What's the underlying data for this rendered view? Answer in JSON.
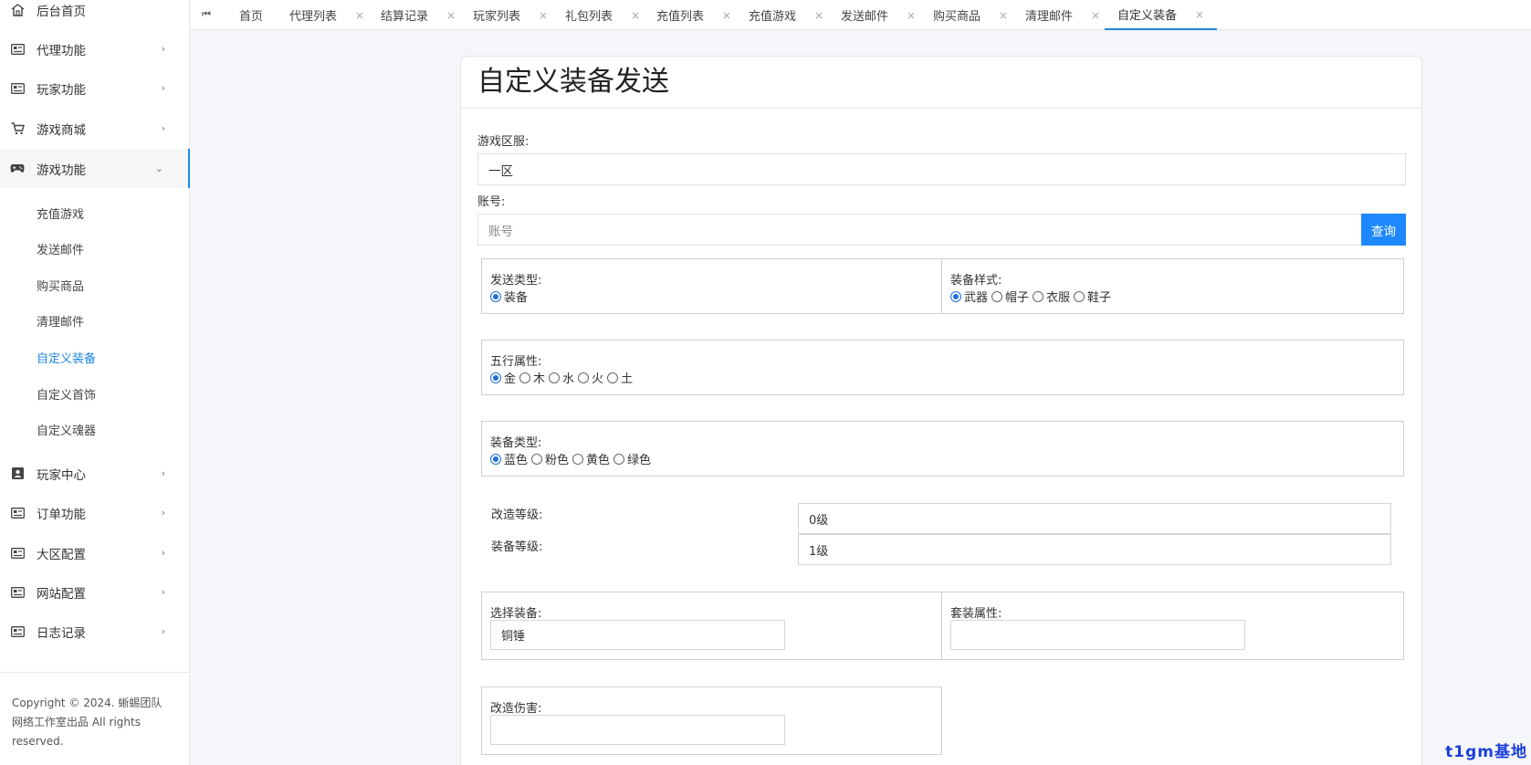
{
  "sidebar": {
    "items": [
      {
        "label": "后台首页",
        "icon": "home-icon"
      },
      {
        "label": "代理功能",
        "icon": "card-icon"
      },
      {
        "label": "玩家功能",
        "icon": "card-icon"
      },
      {
        "label": "游戏商城",
        "icon": "cart-icon"
      },
      {
        "label": "游戏功能",
        "icon": "gamepad-icon"
      },
      {
        "label": "玩家中心",
        "icon": "contact-icon"
      },
      {
        "label": "订单功能",
        "icon": "card-icon"
      },
      {
        "label": "大区配置",
        "icon": "card-icon"
      },
      {
        "label": "网站配置",
        "icon": "card-icon"
      },
      {
        "label": "日志记录",
        "icon": "card-icon"
      }
    ],
    "sub_items": [
      "充值游戏",
      "发送邮件",
      "购买商品",
      "清理邮件",
      "自定义装备",
      "自定义首饰",
      "自定义魂器"
    ],
    "copyright": "Copyright © 2024. 蜥蜴团队网络工作室出品 All rights reserved."
  },
  "tabs": [
    "首页",
    "代理列表",
    "结算记录",
    "玩家列表",
    "礼包列表",
    "充值列表",
    "充值游戏",
    "发送邮件",
    "购买商品",
    "清理邮件",
    "自定义装备"
  ],
  "tab_close": "×",
  "form": {
    "title": "自定义装备发送",
    "server_label": "游戏区服:",
    "server_value": "一区",
    "account_label": "账号:",
    "account_placeholder": "账号",
    "query_button": "查询",
    "send_type_label": "发送类型:",
    "send_type_options": [
      "装备"
    ],
    "style_label": "装备样式:",
    "style_options": [
      "武器",
      "帽子",
      "衣服",
      "鞋子"
    ],
    "element_label": "五行属性:",
    "element_options": [
      "金",
      "木",
      "水",
      "火",
      "土"
    ],
    "equip_type_label": "装备类型:",
    "equip_type_options": [
      "蓝色",
      "粉色",
      "黄色",
      "绿色"
    ],
    "refine_level_label": "改造等级:",
    "refine_level_value": "0级",
    "equip_level_label": "装备等级:",
    "equip_level_value": "1级",
    "select_equip_label": "选择装备:",
    "select_equip_value": "铜锤",
    "set_attr_label": "套装属性:",
    "refine_damage_label": "改造伤害:"
  },
  "watermark": "t1gm基地"
}
